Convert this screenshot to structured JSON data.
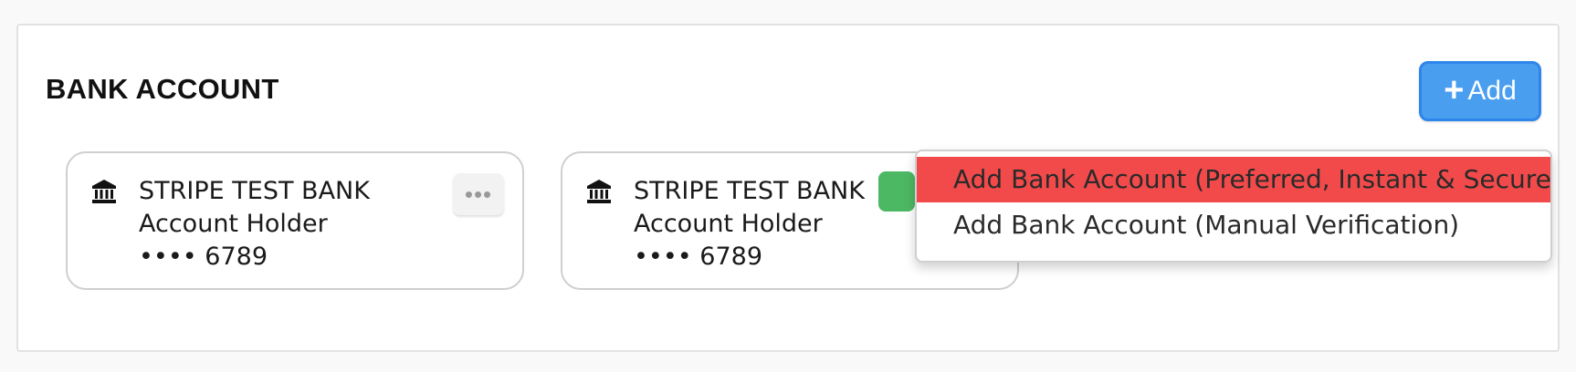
{
  "section": {
    "title": "BANK ACCOUNT"
  },
  "add_button": {
    "icon": "plus-icon",
    "label": "Add",
    "color": "#4a9ef0"
  },
  "accounts": [
    {
      "icon": "bank-icon",
      "bank_name": "STRIPE TEST BANK",
      "holder": "Account Holder",
      "masked_number": "•••• 6789",
      "menu_label": "•••"
    },
    {
      "icon": "bank-icon",
      "bank_name": "STRIPE TEST BANK",
      "holder": "Account Holder",
      "masked_number": "•••• 6789",
      "badge_color": "#4cb863"
    }
  ],
  "dropdown": {
    "items": [
      {
        "label": "Add Bank Account (Preferred, Instant & Secure)",
        "highlighted": true,
        "highlight_color": "#f24a4a"
      },
      {
        "label": "Add Bank Account (Manual Verification)",
        "highlighted": false
      }
    ]
  }
}
